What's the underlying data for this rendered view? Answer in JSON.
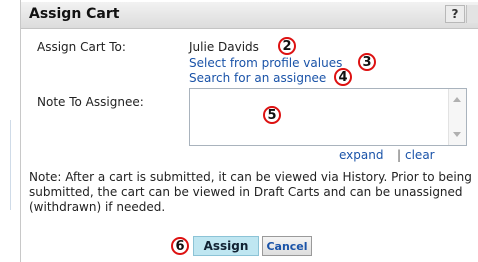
{
  "dialog": {
    "title": "Assign Cart",
    "help_label": "?"
  },
  "assign": {
    "label": "Assign Cart To:",
    "assignee_name": "Julie Davids",
    "link_profile": "Select from profile values",
    "link_search": "Search for an assignee"
  },
  "note": {
    "label": "Note To Assignee:",
    "value": "",
    "expand_label": "expand",
    "separator": "|",
    "clear_label": "clear"
  },
  "info_text": "Note: After a cart is submitted, it can be viewed via History. Prior to being submitted, the cart can be viewed in Draft Carts and can be unassigned (withdrawn) if needed.",
  "buttons": {
    "assign_label": "Assign",
    "cancel_label": "Cancel"
  },
  "callouts": [
    "2",
    "3",
    "4",
    "5",
    "6"
  ],
  "colors": {
    "callout_border": "#dd1111",
    "link": "#1a53a8",
    "assign_button_bg": "#bfe6f1"
  }
}
